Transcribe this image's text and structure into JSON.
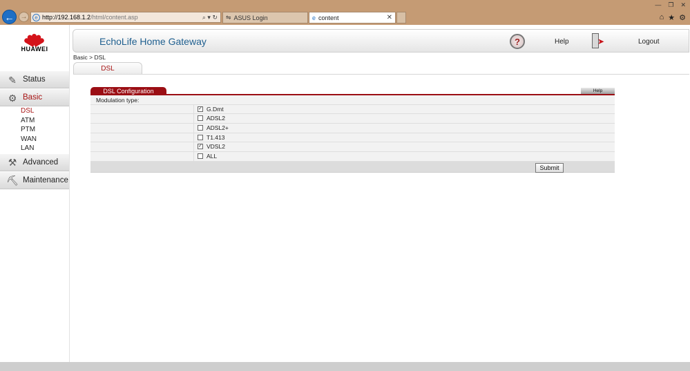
{
  "browser": {
    "url_host": "http://192.168.1.2",
    "url_path": "/html/content.asp",
    "address_controls": "⌕ ▾ ↻",
    "tabs": [
      {
        "label": "ASUS Login"
      },
      {
        "label": "content"
      }
    ],
    "tab_close": "✕"
  },
  "logo": {
    "text": "HUAWEI"
  },
  "header": {
    "title": "EchoLife Home Gateway",
    "help": "Help",
    "logout": "Logout"
  },
  "sidebar": {
    "items": [
      {
        "label": "Status"
      },
      {
        "label": "Basic"
      },
      {
        "label": "Advanced"
      },
      {
        "label": "Maintenance"
      }
    ],
    "subitems": [
      {
        "label": "DSL"
      },
      {
        "label": "ATM"
      },
      {
        "label": "PTM"
      },
      {
        "label": "WAN"
      },
      {
        "label": "LAN"
      }
    ]
  },
  "breadcrumb": "Basic > DSL",
  "page_tab": "DSL",
  "panel": {
    "title": "DSL Configuration",
    "help": "Help",
    "modulation_label": "Modulation type:",
    "options": [
      {
        "label": "G.Dmt",
        "checked": true
      },
      {
        "label": "ADSL2",
        "checked": false
      },
      {
        "label": "ADSL2+",
        "checked": false
      },
      {
        "label": "T1.413",
        "checked": false
      },
      {
        "label": "VDSL2",
        "checked": true
      },
      {
        "label": "ALL",
        "checked": false
      }
    ],
    "submit": "Submit"
  },
  "colors": {
    "brand_red": "#9b0e14",
    "title_blue": "#1f5f8f",
    "chrome": "#c59b74"
  }
}
